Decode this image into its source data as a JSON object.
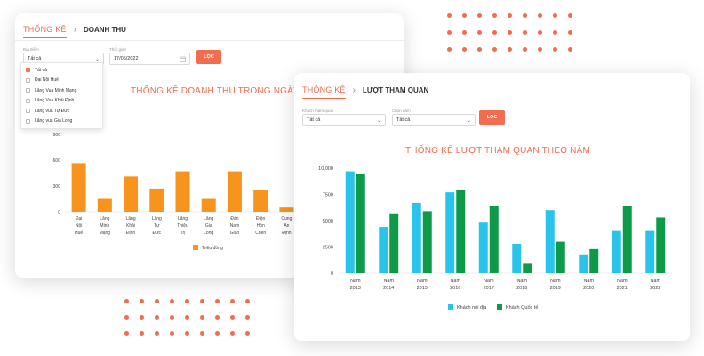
{
  "colors": {
    "accent": "#f26c4f",
    "orange_bar": "#f7941d",
    "cyan_bar": "#29c4ec",
    "green_bar": "#0d9b4a"
  },
  "card_revenue": {
    "breadcrumb_root": "THỐNG KÊ",
    "breadcrumb_current": "DOANH THU",
    "location_label": "Địa điểm",
    "location_value": "Tất cả",
    "date_label": "Thời gian",
    "date_value": "17/05/2022",
    "filter_button": "LỌC",
    "dropdown_items": [
      {
        "label": "Tất cả",
        "checked": true
      },
      {
        "label": "Đại Nội Huế",
        "checked": false
      },
      {
        "label": "Lăng Vua Minh Mạng",
        "checked": false
      },
      {
        "label": "Lăng Vua Khải Định",
        "checked": false
      },
      {
        "label": "Lăng vua Tự Đức",
        "checked": false
      },
      {
        "label": "Lăng vua Gia Long",
        "checked": false
      }
    ]
  },
  "card_visits": {
    "breadcrumb_root": "THỐNG KÊ",
    "breadcrumb_current": "LƯỢT THAM QUAN",
    "visitor_label": "Khách tham quan",
    "visitor_value": "Tất cả",
    "year_label": "Chọn năm",
    "year_value": "Tất cả",
    "filter_button": "LỌC"
  },
  "chart_data": [
    {
      "type": "bar",
      "title": "THỐNG KÊ DOANH THU TRONG NGÀY",
      "categories": [
        [
          "Đại",
          "Nội",
          "Huế"
        ],
        [
          "Lăng",
          "Minh",
          "Mạng"
        ],
        [
          "Lăng",
          "Khải",
          "Định"
        ],
        [
          "Lăng",
          "Tự",
          "Đức"
        ],
        [
          "Lăng",
          "Thiệu",
          "Trị"
        ],
        [
          "Lăng",
          "Gia",
          "Long"
        ],
        [
          "Đàn",
          "Nam",
          "Giao"
        ],
        [
          "Điện",
          "Hòn",
          "Chén"
        ],
        [
          "Cung",
          "An",
          "Định"
        ]
      ],
      "series": [
        {
          "name": "Triệu đồng",
          "values": [
            565,
            150,
            410,
            270,
            470,
            150,
            470,
            250,
            50
          ]
        }
      ],
      "yticks": [
        "0",
        "300",
        "600",
        "900"
      ],
      "ylim": [
        0,
        900
      ],
      "legend": "bottom",
      "grid": false
    },
    {
      "type": "bar",
      "title": "THỐNG KÊ LƯỢT THAM QUAN THEO NĂM",
      "categories": [
        [
          "Năm",
          "2013"
        ],
        [
          "Năm",
          "2014"
        ],
        [
          "Năm",
          "2015"
        ],
        [
          "Năm",
          "2016"
        ],
        [
          "Năm",
          "2017"
        ],
        [
          "Năm",
          "2018"
        ],
        [
          "Năm",
          "2019"
        ],
        [
          "Năm",
          "2020"
        ],
        [
          "Năm",
          "2021"
        ],
        [
          "Năm",
          "2022"
        ]
      ],
      "series": [
        {
          "name": "Khách nội địa",
          "values": [
            9700,
            4400,
            6700,
            7700,
            4900,
            2800,
            6000,
            1800,
            4100,
            4100
          ]
        },
        {
          "name": "Khách Quốc tế",
          "values": [
            9500,
            5700,
            5900,
            7900,
            6400,
            900,
            3000,
            2300,
            6400,
            5300
          ]
        }
      ],
      "yticks": [
        "0",
        "2500",
        "5000",
        "7500",
        "10,000"
      ],
      "ylim": [
        0,
        10000
      ],
      "legend": "bottom",
      "grid": false
    }
  ]
}
